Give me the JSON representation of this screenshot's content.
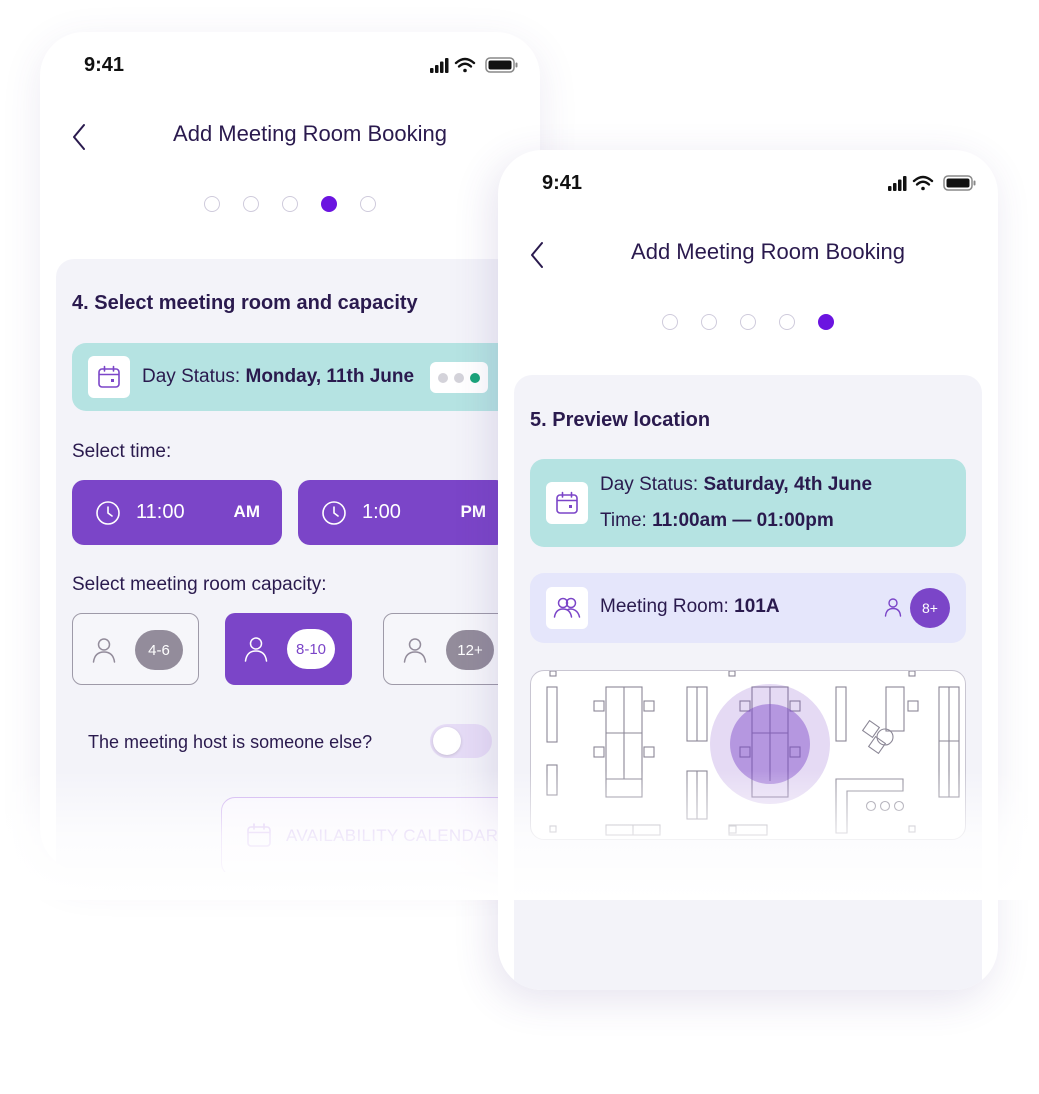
{
  "colors": {
    "accent": "#6b14e0",
    "button_purple": "#7b45c8",
    "teal": "#b5e3e2",
    "lavender": "#e5e6fb",
    "text_dark": "#2a1a4e"
  },
  "left_phone": {
    "status_time": "9:41",
    "title": "Add Meeting Room Booking",
    "steps_total": 5,
    "active_step": 4,
    "step_title": "4. Select meeting room and capacity",
    "day_status_label": "Day Status:",
    "day_status_value": "Monday, 11th June",
    "select_time_label": "Select time:",
    "start_time": {
      "value": "11:00",
      "period": "AM"
    },
    "end_time": {
      "value": "1:00",
      "period": "PM"
    },
    "capacity_label": "Select meeting room capacity:",
    "capacity_options": [
      {
        "label": "4-6",
        "selected": false
      },
      {
        "label": "8-10",
        "selected": true
      },
      {
        "label": "12+",
        "selected": false
      }
    ],
    "host_toggle_label": "The meeting host is someone else?",
    "host_toggle_on": false,
    "availability_button": "AVAILABILITY CALENDAR"
  },
  "right_phone": {
    "status_time": "9:41",
    "title": "Add Meeting Room Booking",
    "steps_total": 5,
    "active_step": 5,
    "step_title": "5. Preview location",
    "day_status_label": "Day Status:",
    "day_status_value": "Saturday, 4th June",
    "time_label": "Time:",
    "time_value": "11:00am — 01:00pm",
    "room_label": "Meeting Room:",
    "room_value": "101A",
    "room_capacity": "8+"
  },
  "icons": [
    "signal-icon",
    "wifi-icon",
    "battery-icon",
    "back-arrow-icon",
    "calendar-icon",
    "clock-icon",
    "person-icon",
    "people-icon"
  ]
}
